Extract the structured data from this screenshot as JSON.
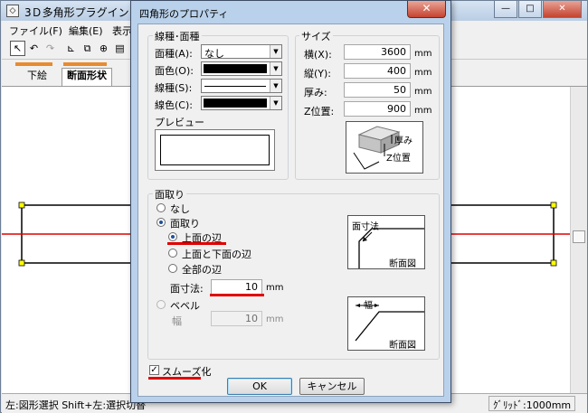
{
  "main_window": {
    "title": "3Ｄ多角形プラグイン",
    "menu": [
      "ファイル(F)",
      "編集(E)",
      "表示("
    ],
    "tabs": [
      "下絵",
      "断面形状"
    ],
    "status_left": "左:図形選択 Shift+左:選択切替",
    "status_right": "ｸﾞﾘｯﾄﾞ:1000mm",
    "title_buttons": {
      "minimize": "—",
      "maximize": "□",
      "close": "✕"
    }
  },
  "dialog": {
    "title": "四角形のプロパティ",
    "close_glyph": "✕",
    "line_fill_group": {
      "label": "線種･面種",
      "fill_type_label": "面種(A):",
      "fill_type_value": "なし",
      "fill_color_label": "面色(O):",
      "line_type_label": "線種(S):",
      "line_color_label": "線色(C):",
      "preview_label": "プレビュー"
    },
    "size_group": {
      "label": "サイズ",
      "width_label": "横(X):",
      "width_value": "3600",
      "depth_label": "縦(Y):",
      "depth_value": "400",
      "thickness_label": "厚み:",
      "thickness_value": "50",
      "z_label": "Z位置:",
      "z_value": "900",
      "unit": "mm",
      "diagram_thickness": "厚み",
      "diagram_z": "Z位置"
    },
    "chamfer_group": {
      "label": "面取り",
      "opt_none": "なし",
      "opt_chamfer": "面取り",
      "sub_top": "上面の辺",
      "sub_top_bottom": "上面と下面の辺",
      "sub_all": "全部の辺",
      "size_label": "面寸法:",
      "size_value": "10",
      "opt_bevel": "ベベル",
      "width_label": "幅",
      "width_value": "10",
      "unit": "mm",
      "diagram1_top": "面寸法",
      "diagram1_bottom": "断面図",
      "diagram2_top": "幅",
      "diagram2_bottom": "断面図"
    },
    "smooth_label": "スムーズ化",
    "ok_label": "OK",
    "cancel_label": "キャンセル"
  }
}
